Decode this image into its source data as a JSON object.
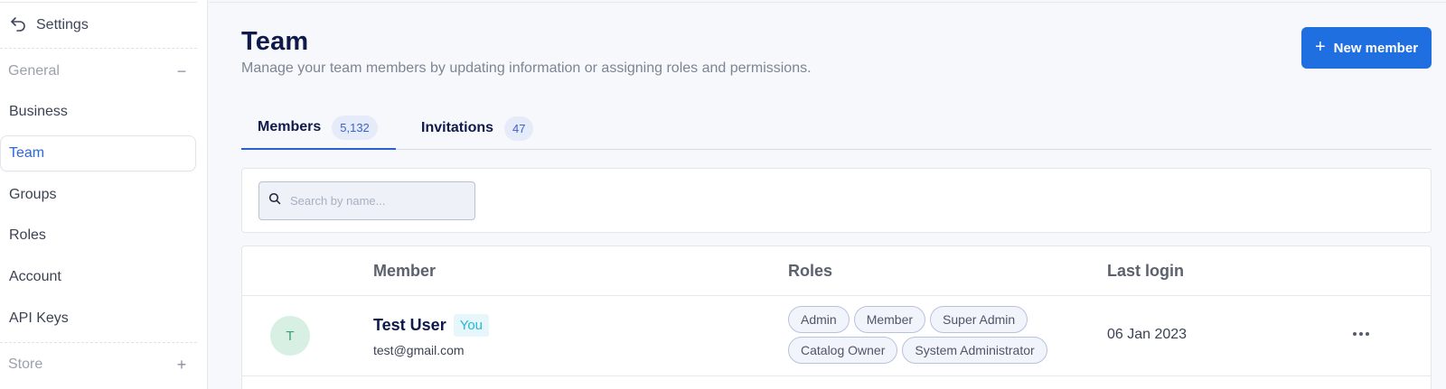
{
  "sidebar": {
    "back_label": "Settings",
    "sections": [
      {
        "label": "General",
        "toggle": "−"
      },
      {
        "label": "Store",
        "toggle": "+"
      }
    ],
    "items": [
      {
        "label": "Business"
      },
      {
        "label": "Team",
        "active": true
      },
      {
        "label": "Groups"
      },
      {
        "label": "Roles"
      },
      {
        "label": "Account"
      },
      {
        "label": "API Keys"
      }
    ]
  },
  "header": {
    "title": "Team",
    "subtitle": "Manage your team members by updating information or assigning roles and permissions.",
    "new_member_label": "New member",
    "new_member_icon": "+"
  },
  "tabs": [
    {
      "label": "Members",
      "count": "5,132",
      "active": true
    },
    {
      "label": "Invitations",
      "count": "47",
      "active": false
    }
  ],
  "search": {
    "placeholder": "Search by name...",
    "value": ""
  },
  "table": {
    "columns": [
      "Member",
      "Roles",
      "Last login"
    ],
    "rows": [
      {
        "avatar_initial": "T",
        "name": "Test User",
        "badge": "You",
        "email": "test@gmail.com",
        "roles": [
          "Admin",
          "Member",
          "Super Admin",
          "Catalog Owner",
          "System Administrator"
        ],
        "last_login": "06 Jan 2023"
      }
    ]
  },
  "colors": {
    "accent": "#1f6fe0",
    "active_nav": "#2a67e0",
    "title": "#0f1a4a",
    "avatar_bg": "#d8efe3",
    "avatar_fg": "#39a36c",
    "you_badge": "#22b8d8"
  },
  "icons": {
    "back": "back-arrow-icon",
    "search": "search-icon",
    "plus": "plus-icon",
    "more": "more-horizontal-icon"
  }
}
